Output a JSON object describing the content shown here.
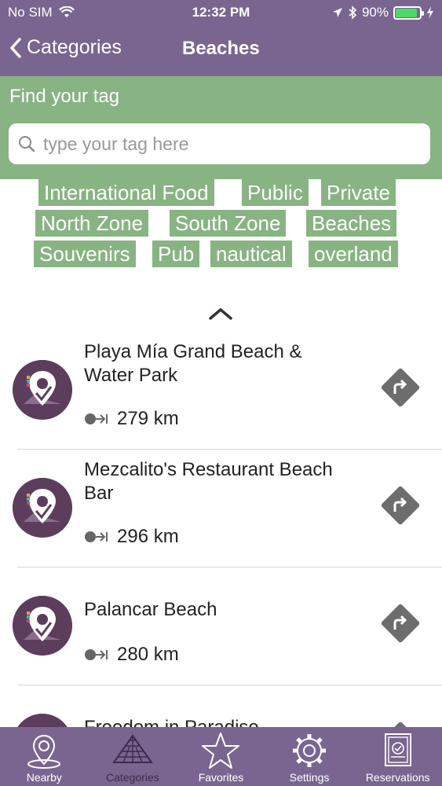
{
  "status_bar": {
    "carrier": "No SIM",
    "time": "12:32 PM",
    "battery": "90%",
    "battery_level": 0.9
  },
  "navbar": {
    "back_label": "Categories",
    "title": "Beaches"
  },
  "tag_search": {
    "label": "Find your tag",
    "placeholder": "type your tag here"
  },
  "tags": [
    "International Food",
    "Public",
    "Private",
    "North Zone",
    "South Zone",
    "Beaches",
    "Souvenirs",
    "Pub",
    "nautical",
    "overland"
  ],
  "places": [
    {
      "name": "Playa Mía Grand Beach & Water Park",
      "distance": "279 km"
    },
    {
      "name": "Mezcalito's Restaurant Beach Bar",
      "distance": "296 km"
    },
    {
      "name": "Palancar Beach",
      "distance": "280 km"
    },
    {
      "name": "Freedom in Paradise",
      "distance": ""
    }
  ],
  "tabs": [
    {
      "label": "Nearby",
      "icon": "location-pin-icon"
    },
    {
      "label": "Categories",
      "icon": "pyramid-icon",
      "active": true
    },
    {
      "label": "Favorites",
      "icon": "star-icon"
    },
    {
      "label": "Settings",
      "icon": "gear-icon"
    },
    {
      "label": "Reservations",
      "icon": "reservations-icon"
    }
  ],
  "colors": {
    "header": "#7a6590",
    "tag_green": "#88b383",
    "logo": "#5c3e5c",
    "direction": "#6d6d6d",
    "battery": "#4cd964"
  }
}
